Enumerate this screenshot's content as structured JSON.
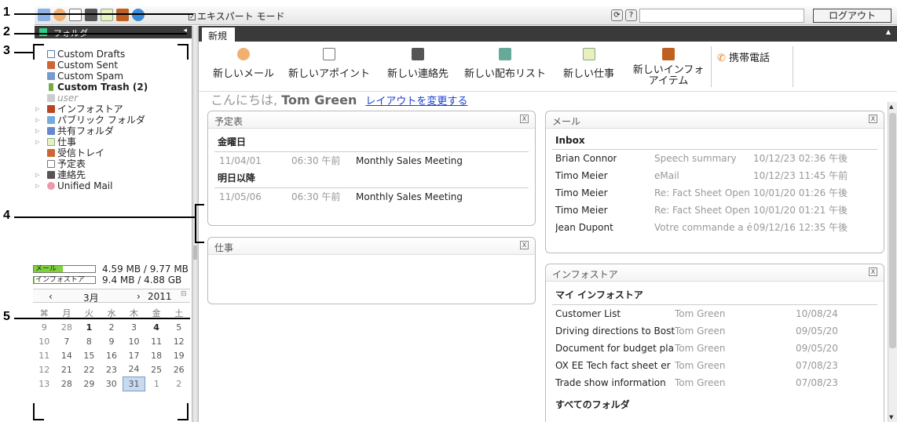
{
  "annotations": [
    "1",
    "2",
    "3",
    "4",
    "5"
  ],
  "toolbar": {
    "expert_mode": "エキスパート モード",
    "logout": "ログアウト",
    "refresh_glyph": "⟳",
    "help_glyph": "?"
  },
  "folders": {
    "title": "フォルダ",
    "items": [
      {
        "label": "Custom Drafts"
      },
      {
        "label": "Custom Sent"
      },
      {
        "label": "Custom Spam"
      },
      {
        "label": "Custom Trash (2)"
      },
      {
        "label": "user"
      },
      {
        "label": "インフォストア"
      },
      {
        "label": "パブリック フォルダ"
      },
      {
        "label": "共有フォルダ"
      },
      {
        "label": "仕事"
      },
      {
        "label": "受信トレイ"
      },
      {
        "label": "予定表"
      },
      {
        "label": "連絡先"
      },
      {
        "label": "Unified Mail"
      }
    ]
  },
  "quota": {
    "mail_label": "メール",
    "mail_text": "4.59 MB / 9.77 MB",
    "mail_fraction": 0.47,
    "infostore_label": "インフォストア",
    "infostore_text": "9.4 MB / 4.88 GB",
    "infostore_fraction": 0.002
  },
  "calendar": {
    "month": "3月",
    "year": "2011",
    "prev": "‹",
    "next": "›",
    "weekdays": [
      "",
      "月",
      "火",
      "水",
      "木",
      "金",
      "土"
    ],
    "rows": [
      [
        "9",
        "28",
        "1",
        "2",
        "3",
        "4",
        "5"
      ],
      [
        "10",
        "7",
        "8",
        "9",
        "10",
        "11",
        "12"
      ],
      [
        "11",
        "14",
        "15",
        "16",
        "17",
        "18",
        "19"
      ],
      [
        "12",
        "21",
        "22",
        "23",
        "24",
        "25",
        "26"
      ],
      [
        "13",
        "28",
        "29",
        "30",
        "31",
        "1",
        "2"
      ]
    ]
  },
  "tabs": {
    "new": "新規"
  },
  "new_items": [
    {
      "label": "新しいメール"
    },
    {
      "label": "新しいアポイント"
    },
    {
      "label": "新しい連絡先"
    },
    {
      "label": "新しい配布リスト"
    },
    {
      "label": "新しい仕事"
    },
    {
      "label": "新しいインフォ\nアイテム"
    }
  ],
  "phone": "携帯電話",
  "greeting": {
    "prefix": "こんにちは, ",
    "name": "Tom Green",
    "link": "レイアウトを変更する"
  },
  "schedule": {
    "title": "予定表",
    "today_heading": "金曜日",
    "later_heading": "明日以降",
    "today": [
      {
        "date": "11/04/01",
        "time": "06:30 午前",
        "subject": "Monthly Sales Meeting"
      }
    ],
    "later": [
      {
        "date": "11/05/06",
        "time": "06:30 午前",
        "subject": "Monthly Sales Meeting"
      }
    ]
  },
  "tasks": {
    "title": "仕事"
  },
  "mail": {
    "title": "メール",
    "folder": "Inbox",
    "rows": [
      {
        "from": "Brian Connor",
        "subject": "Speech summary",
        "date": "10/12/23 02:36 午後"
      },
      {
        "from": "Timo Meier",
        "subject": "eMail",
        "date": "10/12/23 11:45 午前"
      },
      {
        "from": "Timo Meier",
        "subject": "Re: Fact Sheet Open",
        "date": "10/01/20 01:26 午後"
      },
      {
        "from": "Timo Meier",
        "subject": "Re: Fact Sheet Open",
        "date": "10/01/20 01:21 午後"
      },
      {
        "from": "Jean Dupont",
        "subject": "Votre commande a é",
        "date": "09/12/16 12:35 午後"
      }
    ]
  },
  "infostore": {
    "title": "インフォストア",
    "my_heading": "マイ インフォストア",
    "all_heading": "すべてのフォルダ",
    "rows": [
      {
        "name": "Customer List",
        "owner": "Tom Green",
        "date": "10/08/24"
      },
      {
        "name": "Driving directions to Bost",
        "owner": "Tom Green",
        "date": "09/05/20"
      },
      {
        "name": "Document for budget plan",
        "owner": "Tom Green",
        "date": "09/05/20"
      },
      {
        "name": "OX EE Tech fact sheet er",
        "owner": "Tom Green",
        "date": "07/08/23"
      },
      {
        "name": "Trade show information",
        "owner": "Tom Green",
        "date": "07/08/23"
      }
    ]
  },
  "close_glyph": "X"
}
